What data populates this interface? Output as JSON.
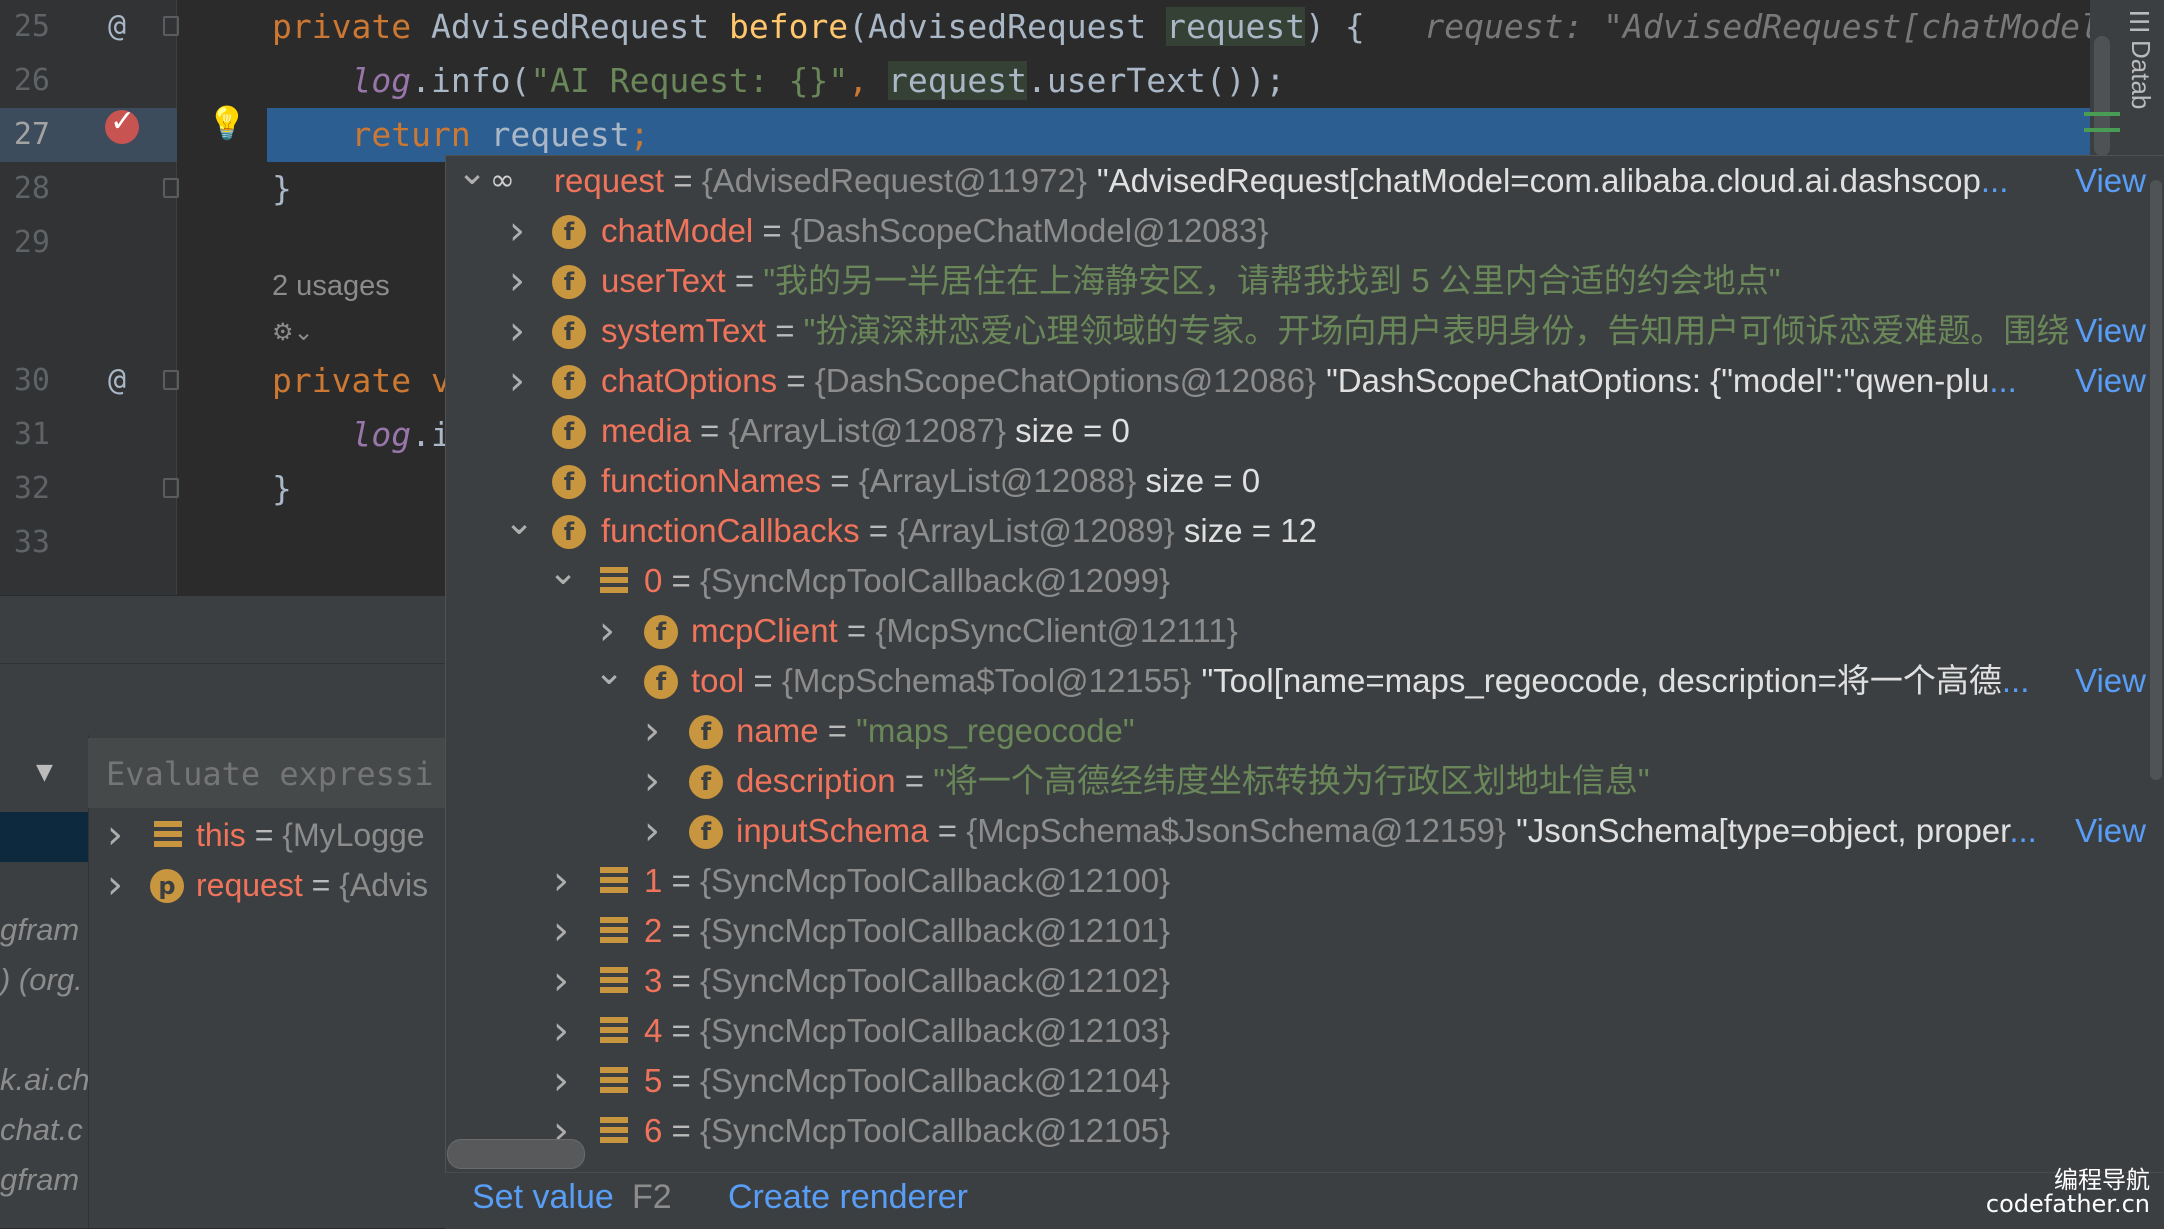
{
  "editor": {
    "lines": [
      {
        "num": "25",
        "tokens": [
          {
            "t": "private ",
            "c": "kw"
          },
          {
            "t": "AdvisedRequest ",
            "c": ""
          },
          {
            "t": "before",
            "c": "fn"
          },
          {
            "t": "(AdvisedRequest ",
            "c": ""
          },
          {
            "t": "request",
            "c": "hlarg"
          },
          {
            "t": ") {   ",
            "c": ""
          },
          {
            "t": "request: \"AdvisedRequest[chatModel=",
            "c": "hint"
          }
        ]
      },
      {
        "num": "26",
        "tokens": [
          {
            "t": "    ",
            "c": ""
          },
          {
            "t": "log",
            "c": "it"
          },
          {
            "t": ".info(",
            "c": ""
          },
          {
            "t": "\"AI Request: {}\"",
            "c": "str"
          },
          {
            "t": ", ",
            "c": "kw"
          },
          {
            "t": "request",
            "c": "hlarg"
          },
          {
            "t": ".userText());",
            "c": ""
          }
        ]
      },
      {
        "num": "27",
        "tokens": [
          {
            "t": "    ",
            "c": ""
          },
          {
            "t": "return ",
            "c": "kw"
          },
          {
            "t": "request",
            "c": ""
          },
          {
            "t": ";",
            "c": "kw"
          }
        ]
      },
      {
        "num": "28",
        "tokens": [
          {
            "t": "}",
            "c": ""
          }
        ]
      },
      {
        "num": "29",
        "tokens": []
      },
      {
        "num": "30",
        "tokens": [
          {
            "t": "private v",
            "c": "kw"
          }
        ]
      },
      {
        "num": "31",
        "tokens": [
          {
            "t": "    ",
            "c": ""
          },
          {
            "t": "log",
            "c": "it"
          },
          {
            "t": ".i",
            "c": ""
          }
        ]
      },
      {
        "num": "32",
        "tokens": [
          {
            "t": "}",
            "c": ""
          }
        ]
      },
      {
        "num": "33",
        "tokens": []
      }
    ],
    "at_symbol": "@",
    "usages_label": "2 usages",
    "side_label": "Datab"
  },
  "debugger": {
    "eval_placeholder": "Evaluate expressi",
    "frames": [
      "gfram",
      ") (org.",
      "k.ai.ch",
      "chat.c",
      "gfram"
    ],
    "vars": [
      {
        "name": "this",
        "ref": "{MyLogge",
        "icon": "array"
      },
      {
        "name": "request",
        "ref": "{Advis",
        "icon": "p"
      }
    ]
  },
  "inspector": {
    "view_label": "View",
    "rows": [
      {
        "level": 0,
        "arrow": "down",
        "icon": "watch",
        "name": "request",
        "ref": "{AdvisedRequest@11972}",
        "value": "\"AdvisedRequest[chatModel=com.alibaba.cloud.ai.dashscop",
        "ellipsis": "...",
        "view": true
      },
      {
        "level": 1,
        "arrow": "right",
        "icon": "f",
        "name": "chatModel",
        "ref": "{DashScopeChatModel@12083}"
      },
      {
        "level": 1,
        "arrow": "right",
        "icon": "f",
        "name": "userText",
        "svalue": "\"我的另一半居住在上海静安区，请帮我找到 5 公里内合适的约会地点\""
      },
      {
        "level": 1,
        "arrow": "right",
        "icon": "f",
        "name": "systemText",
        "svalue": "\"扮演深耕恋爱心理领域的专家。开场向用户表明身份，告知用户可倾诉恋爱难题。围绕",
        "ellipsis": "...",
        "view": true
      },
      {
        "level": 1,
        "arrow": "right",
        "icon": "f",
        "name": "chatOptions",
        "ref": "{DashScopeChatOptions@12086}",
        "value": "\"DashScopeChatOptions: {\"model\":\"qwen-plu",
        "ellipsis": "...",
        "view": true
      },
      {
        "level": 1,
        "arrow": "",
        "icon": "f",
        "name": "media",
        "ref": "{ArrayList@12087}",
        "value": " size = 0"
      },
      {
        "level": 1,
        "arrow": "",
        "icon": "f",
        "name": "functionNames",
        "ref": "{ArrayList@12088}",
        "value": " size = 0"
      },
      {
        "level": 1,
        "arrow": "down",
        "icon": "f",
        "name": "functionCallbacks",
        "ref": "{ArrayList@12089}",
        "value": " size = 12"
      },
      {
        "level": 2,
        "arrow": "down",
        "icon": "array",
        "name": "0",
        "ref": "{SyncMcpToolCallback@12099}"
      },
      {
        "level": 3,
        "arrow": "right",
        "icon": "f",
        "name": "mcpClient",
        "ref": "{McpSyncClient@12111}"
      },
      {
        "level": 3,
        "arrow": "down",
        "icon": "f",
        "name": "tool",
        "ref": "{McpSchema$Tool@12155}",
        "value": "\"Tool[name=maps_regeocode, description=将一个高德",
        "ellipsis": "...",
        "view": true
      },
      {
        "level": 4,
        "arrow": "right",
        "icon": "f",
        "name": "name",
        "svalue": "\"maps_regeocode\""
      },
      {
        "level": 4,
        "arrow": "right",
        "icon": "f",
        "name": "description",
        "svalue": "\"将一个高德经纬度坐标转换为行政区划地址信息\""
      },
      {
        "level": 4,
        "arrow": "right",
        "icon": "f",
        "name": "inputSchema",
        "ref": "{McpSchema$JsonSchema@12159}",
        "value": "\"JsonSchema[type=object, proper",
        "ellipsis": "...",
        "view": true
      },
      {
        "level": 2,
        "arrow": "right",
        "icon": "array",
        "name": "1",
        "ref": "{SyncMcpToolCallback@12100}"
      },
      {
        "level": 2,
        "arrow": "right",
        "icon": "array",
        "name": "2",
        "ref": "{SyncMcpToolCallback@12101}"
      },
      {
        "level": 2,
        "arrow": "right",
        "icon": "array",
        "name": "3",
        "ref": "{SyncMcpToolCallback@12102}"
      },
      {
        "level": 2,
        "arrow": "right",
        "icon": "array",
        "name": "4",
        "ref": "{SyncMcpToolCallback@12103}"
      },
      {
        "level": 2,
        "arrow": "right",
        "icon": "array",
        "name": "5",
        "ref": "{SyncMcpToolCallback@12104}"
      },
      {
        "level": 2,
        "arrow": "right",
        "icon": "array",
        "name": "6",
        "ref": "{SyncMcpToolCallback@12105}"
      }
    ],
    "set_value_label": "Set value",
    "set_value_key": "F2",
    "create_renderer_label": "Create renderer"
  },
  "watermark": {
    "line1": "编程导航",
    "line2": "codefather.cn"
  }
}
